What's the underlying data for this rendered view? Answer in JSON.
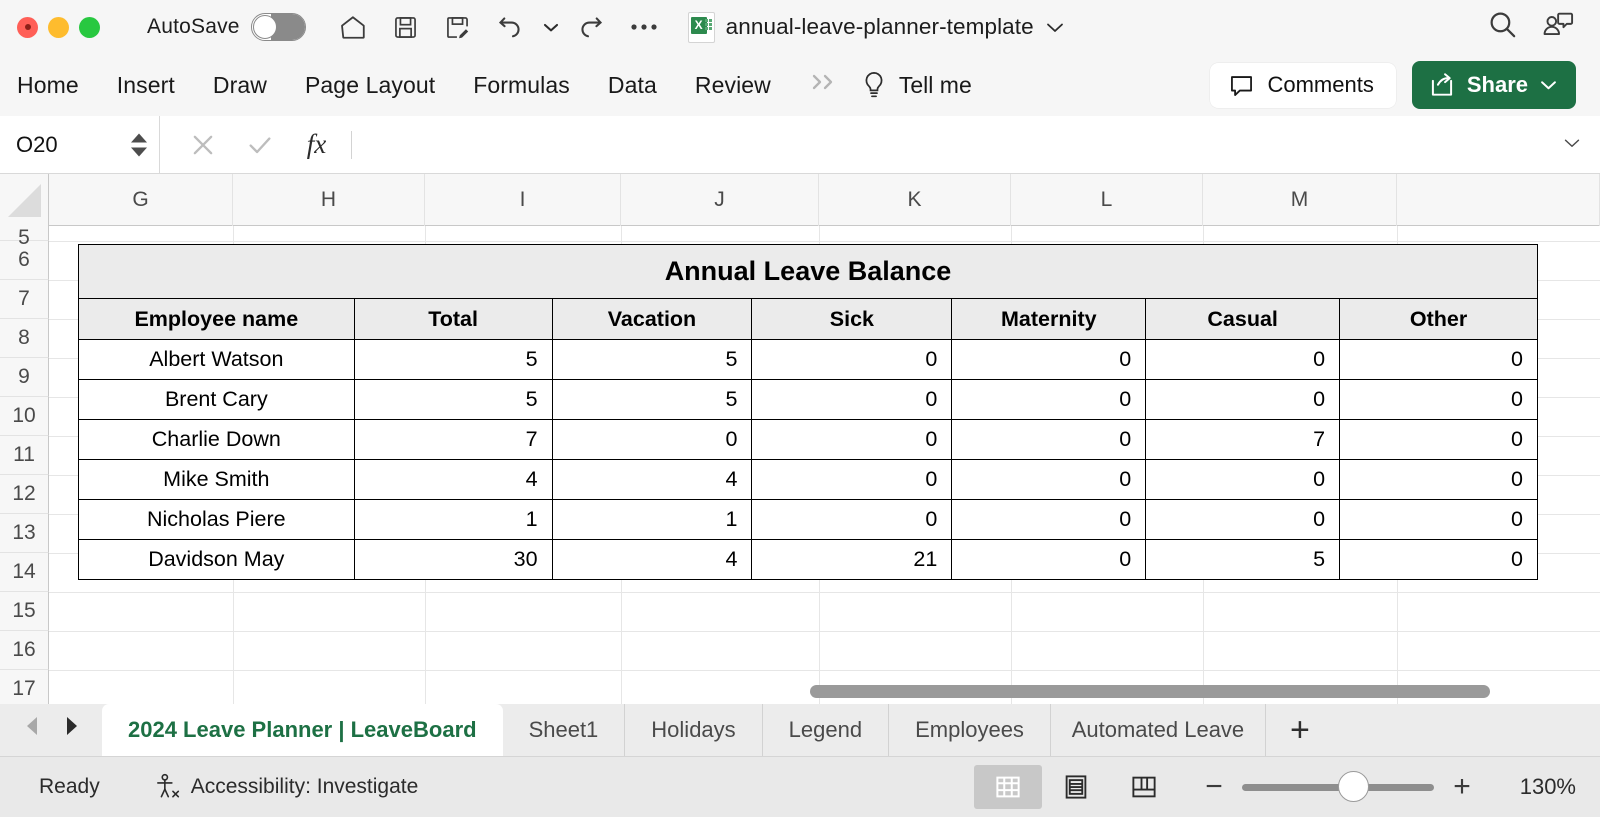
{
  "titlebar": {
    "autosave_label": "AutoSave",
    "autosave_state": "off",
    "filename": "annual-leave-planner-template",
    "icons": [
      "home-icon",
      "save-icon",
      "save-as-icon",
      "undo-icon",
      "undo-dropdown-icon",
      "redo-icon",
      "more-options-icon"
    ],
    "right_icons": [
      "search-icon",
      "collaborators-icon"
    ]
  },
  "ribbon": {
    "tabs": [
      "Home",
      "Insert",
      "Draw",
      "Page Layout",
      "Formulas",
      "Data",
      "Review"
    ],
    "overflow_label": "»",
    "tell_me": "Tell me",
    "comments_label": "Comments",
    "share_label": "Share",
    "share_color": "#1d7044"
  },
  "formula_bar": {
    "name_box": "O20",
    "formula_value": "",
    "cancel_icon": "cancel-icon",
    "confirm_icon": "confirm-icon",
    "function_icon": "fx-icon"
  },
  "grid": {
    "columns": [
      "G",
      "H",
      "I",
      "J",
      "K",
      "L",
      "M"
    ],
    "rows": [
      "5",
      "6",
      "7",
      "8",
      "9",
      "10",
      "11",
      "12",
      "13",
      "14",
      "15",
      "16",
      "17"
    ],
    "zoom": "130%"
  },
  "table": {
    "title": "Annual Leave Balance",
    "headers": [
      "Employee name",
      "Total",
      "Vacation",
      "Sick",
      "Maternity",
      "Casual",
      "Other"
    ],
    "rows": [
      {
        "name": "Albert Watson",
        "total": "5",
        "vacation": "5",
        "sick": "0",
        "maternity": "0",
        "casual": "0",
        "other": "0"
      },
      {
        "name": "Brent Cary",
        "total": "5",
        "vacation": "5",
        "sick": "0",
        "maternity": "0",
        "casual": "0",
        "other": "0"
      },
      {
        "name": "Charlie Down",
        "total": "7",
        "vacation": "0",
        "sick": "0",
        "maternity": "0",
        "casual": "7",
        "other": "0"
      },
      {
        "name": "Mike Smith",
        "total": "4",
        "vacation": "4",
        "sick": "0",
        "maternity": "0",
        "casual": "0",
        "other": "0"
      },
      {
        "name": "Nicholas Piere",
        "total": "1",
        "vacation": "1",
        "sick": "0",
        "maternity": "0",
        "casual": "0",
        "other": "0"
      },
      {
        "name": "Davidson May",
        "total": "30",
        "vacation": "4",
        "sick": "21",
        "maternity": "0",
        "casual": "5",
        "other": "0"
      }
    ]
  },
  "sheet_tabs": {
    "items": [
      {
        "label": "2024 Leave Planner | LeaveBoard",
        "active": true
      },
      {
        "label": "Sheet1",
        "active": false
      },
      {
        "label": "Holidays",
        "active": false
      },
      {
        "label": "Legend",
        "active": false
      },
      {
        "label": "Employees",
        "active": false
      },
      {
        "label": "Automated Leave",
        "active": false,
        "truncated": true
      }
    ],
    "add_label": "+",
    "active_color": "#1d7044"
  },
  "status_bar": {
    "ready": "Ready",
    "accessibility": "Accessibility: Investigate",
    "zoom_percent": "130%",
    "zoom_minus": "−",
    "zoom_plus": "+",
    "views": [
      "normal-view-icon",
      "page-layout-view-icon",
      "page-break-view-icon"
    ]
  }
}
